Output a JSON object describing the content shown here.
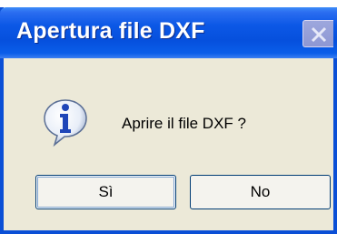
{
  "dialog": {
    "title": "Apertura file DXF",
    "message": "Aprire il file DXF ?",
    "icon": "info-icon",
    "buttons": {
      "yes_label": "Sì",
      "no_label": "No"
    }
  },
  "colors": {
    "titlebar": "#0650dd",
    "body": "#ece9d8",
    "close_disabled": "#9da7dd"
  }
}
